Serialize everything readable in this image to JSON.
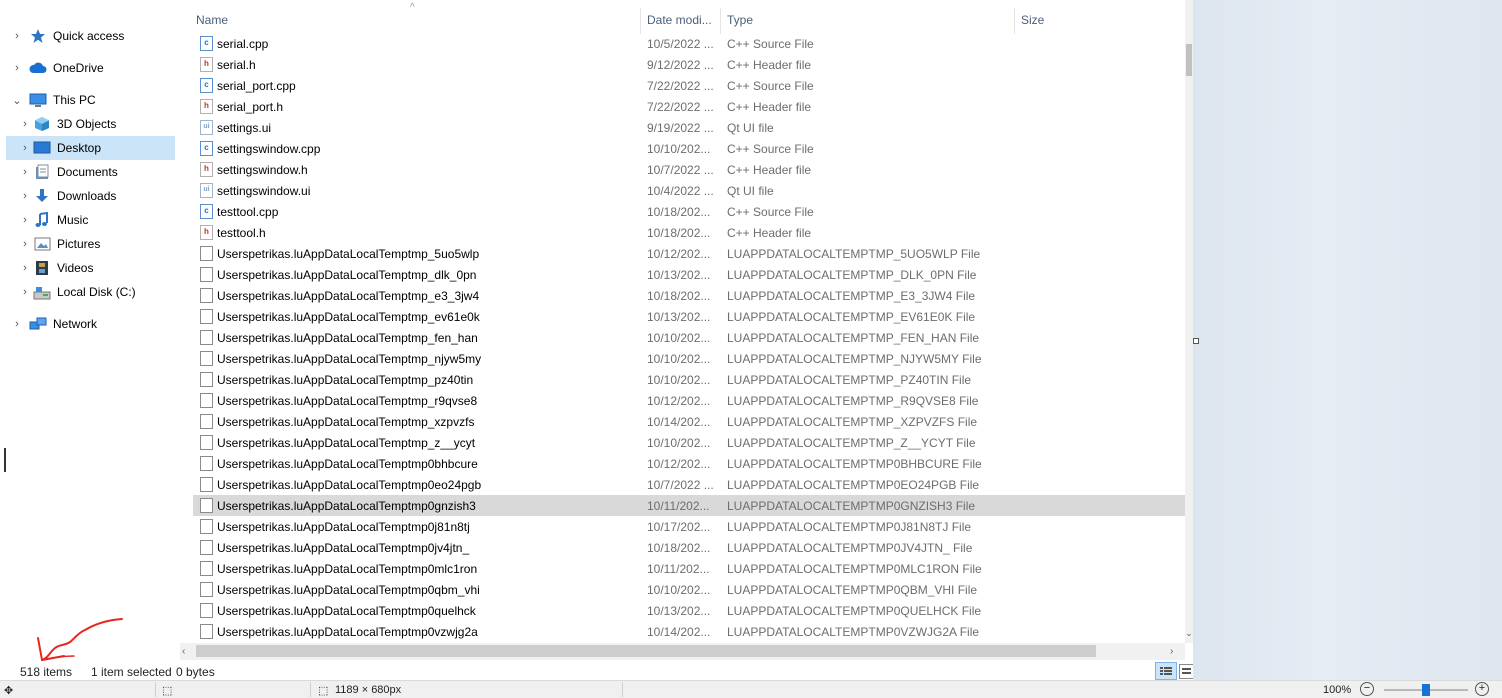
{
  "nav": {
    "items": [
      {
        "label": "Quick access",
        "icon": "star-icon",
        "indent": 0,
        "chevron": "›"
      },
      {
        "label": "OneDrive",
        "icon": "cloud-icon",
        "indent": 0,
        "chevron": "›"
      },
      {
        "label": "This PC",
        "icon": "computer-icon",
        "indent": 0,
        "chevron": "⌄"
      },
      {
        "label": "3D Objects",
        "icon": "cube-icon",
        "indent": 1,
        "chevron": "›"
      },
      {
        "label": "Desktop",
        "icon": "desktop-icon",
        "indent": 1,
        "chevron": "›",
        "selected": true
      },
      {
        "label": "Documents",
        "icon": "documents-icon",
        "indent": 1,
        "chevron": "›"
      },
      {
        "label": "Downloads",
        "icon": "download-arrow-icon",
        "indent": 1,
        "chevron": "›"
      },
      {
        "label": "Music",
        "icon": "music-note-icon",
        "indent": 1,
        "chevron": "›"
      },
      {
        "label": "Pictures",
        "icon": "pictures-icon",
        "indent": 1,
        "chevron": "›"
      },
      {
        "label": "Videos",
        "icon": "film-icon",
        "indent": 1,
        "chevron": "›"
      },
      {
        "label": "Local Disk (C:)",
        "icon": "hard-drive-icon",
        "indent": 1,
        "chevron": "›"
      },
      {
        "label": "Network",
        "icon": "network-icon",
        "indent": 0,
        "chevron": "›"
      }
    ]
  },
  "columns": {
    "name": "Name",
    "date": "Date modi...",
    "type": "Type",
    "size": "Size",
    "sort_arrow": "^"
  },
  "files": [
    {
      "name": "serial.cpp",
      "date": "10/5/2022 ...",
      "type": "C++ Source File",
      "kind": "cpp"
    },
    {
      "name": "serial.h",
      "date": "9/12/2022 ...",
      "type": "C++ Header file",
      "kind": "h"
    },
    {
      "name": "serial_port.cpp",
      "date": "7/22/2022 ...",
      "type": "C++ Source File",
      "kind": "cpp"
    },
    {
      "name": "serial_port.h",
      "date": "7/22/2022 ...",
      "type": "C++ Header file",
      "kind": "h"
    },
    {
      "name": "settings.ui",
      "date": "9/19/2022 ...",
      "type": "Qt UI file",
      "kind": "ui"
    },
    {
      "name": "settingswindow.cpp",
      "date": "10/10/202...",
      "type": "C++ Source File",
      "kind": "cpp"
    },
    {
      "name": "settingswindow.h",
      "date": "10/7/2022 ...",
      "type": "C++ Header file",
      "kind": "h"
    },
    {
      "name": "settingswindow.ui",
      "date": "10/4/2022 ...",
      "type": "Qt UI file",
      "kind": "ui"
    },
    {
      "name": "testtool.cpp",
      "date": "10/18/202...",
      "type": "C++ Source File",
      "kind": "cpp"
    },
    {
      "name": "testtool.h",
      "date": "10/18/202...",
      "type": "C++ Header file",
      "kind": "h"
    },
    {
      "name": "Userspetrikas.luAppDataLocalTemptmp_5uo5wlp",
      "date": "10/12/202...",
      "type": "LUAPPDATALOCALTEMPTMP_5UO5WLP File",
      "kind": "plain"
    },
    {
      "name": "Userspetrikas.luAppDataLocalTemptmp_dlk_0pn",
      "date": "10/13/202...",
      "type": "LUAPPDATALOCALTEMPTMP_DLK_0PN File",
      "kind": "plain"
    },
    {
      "name": "Userspetrikas.luAppDataLocalTemptmp_e3_3jw4",
      "date": "10/18/202...",
      "type": "LUAPPDATALOCALTEMPTMP_E3_3JW4 File",
      "kind": "plain"
    },
    {
      "name": "Userspetrikas.luAppDataLocalTemptmp_ev61e0k",
      "date": "10/13/202...",
      "type": "LUAPPDATALOCALTEMPTMP_EV61E0K File",
      "kind": "plain"
    },
    {
      "name": "Userspetrikas.luAppDataLocalTemptmp_fen_han",
      "date": "10/10/202...",
      "type": "LUAPPDATALOCALTEMPTMP_FEN_HAN File",
      "kind": "plain"
    },
    {
      "name": "Userspetrikas.luAppDataLocalTemptmp_njyw5my",
      "date": "10/10/202...",
      "type": "LUAPPDATALOCALTEMPTMP_NJYW5MY File",
      "kind": "plain"
    },
    {
      "name": "Userspetrikas.luAppDataLocalTemptmp_pz40tin",
      "date": "10/10/202...",
      "type": "LUAPPDATALOCALTEMPTMP_PZ40TIN File",
      "kind": "plain"
    },
    {
      "name": "Userspetrikas.luAppDataLocalTemptmp_r9qvse8",
      "date": "10/12/202...",
      "type": "LUAPPDATALOCALTEMPTMP_R9QVSE8 File",
      "kind": "plain"
    },
    {
      "name": "Userspetrikas.luAppDataLocalTemptmp_xzpvzfs",
      "date": "10/14/202...",
      "type": "LUAPPDATALOCALTEMPTMP_XZPVZFS File",
      "kind": "plain"
    },
    {
      "name": "Userspetrikas.luAppDataLocalTemptmp_z__ycyt",
      "date": "10/10/202...",
      "type": "LUAPPDATALOCALTEMPTMP_Z__YCYT File",
      "kind": "plain"
    },
    {
      "name": "Userspetrikas.luAppDataLocalTemptmp0bhbcure",
      "date": "10/12/202...",
      "type": "LUAPPDATALOCALTEMPTMP0BHBCURE File",
      "kind": "plain"
    },
    {
      "name": "Userspetrikas.luAppDataLocalTemptmp0eo24pgb",
      "date": "10/7/2022 ...",
      "type": "LUAPPDATALOCALTEMPTMP0EO24PGB File",
      "kind": "plain"
    },
    {
      "name": "Userspetrikas.luAppDataLocalTemptmp0gnzish3",
      "date": "10/11/202...",
      "type": "LUAPPDATALOCALTEMPTMP0GNZISH3 File",
      "kind": "plain",
      "selected": true
    },
    {
      "name": "Userspetrikas.luAppDataLocalTemptmp0j81n8tj",
      "date": "10/17/202...",
      "type": "LUAPPDATALOCALTEMPTMP0J81N8TJ File",
      "kind": "plain"
    },
    {
      "name": "Userspetrikas.luAppDataLocalTemptmp0jv4jtn_",
      "date": "10/18/202...",
      "type": "LUAPPDATALOCALTEMPTMP0JV4JTN_ File",
      "kind": "plain"
    },
    {
      "name": "Userspetrikas.luAppDataLocalTemptmp0mlc1ron",
      "date": "10/11/202...",
      "type": "LUAPPDATALOCALTEMPTMP0MLC1RON File",
      "kind": "plain"
    },
    {
      "name": "Userspetrikas.luAppDataLocalTemptmp0qbm_vhi",
      "date": "10/10/202...",
      "type": "LUAPPDATALOCALTEMPTMP0QBM_VHI File",
      "kind": "plain"
    },
    {
      "name": "Userspetrikas.luAppDataLocalTemptmp0quelhck",
      "date": "10/13/202...",
      "type": "LUAPPDATALOCALTEMPTMP0QUELHCK File",
      "kind": "plain"
    },
    {
      "name": "Userspetrikas.luAppDataLocalTemptmp0vzwjg2a",
      "date": "10/14/202...",
      "type": "LUAPPDATALOCALTEMPTMP0VZWJG2A File",
      "kind": "plain"
    }
  ],
  "status": {
    "item_count": "518 items",
    "selection": "1 item selected",
    "size": "0 bytes"
  },
  "app_bar": {
    "move_icon": "move-icon",
    "selection_icon": "selection-icon",
    "dimensions": "1189 × 680px",
    "zoom": "100%",
    "zoom_out": "−",
    "zoom_in": "+"
  },
  "colors": {
    "accent": "#1673d6",
    "selected_nav": "#cce4f7",
    "selected_row": "#d9d9d9",
    "annotation": "#e8261c"
  }
}
